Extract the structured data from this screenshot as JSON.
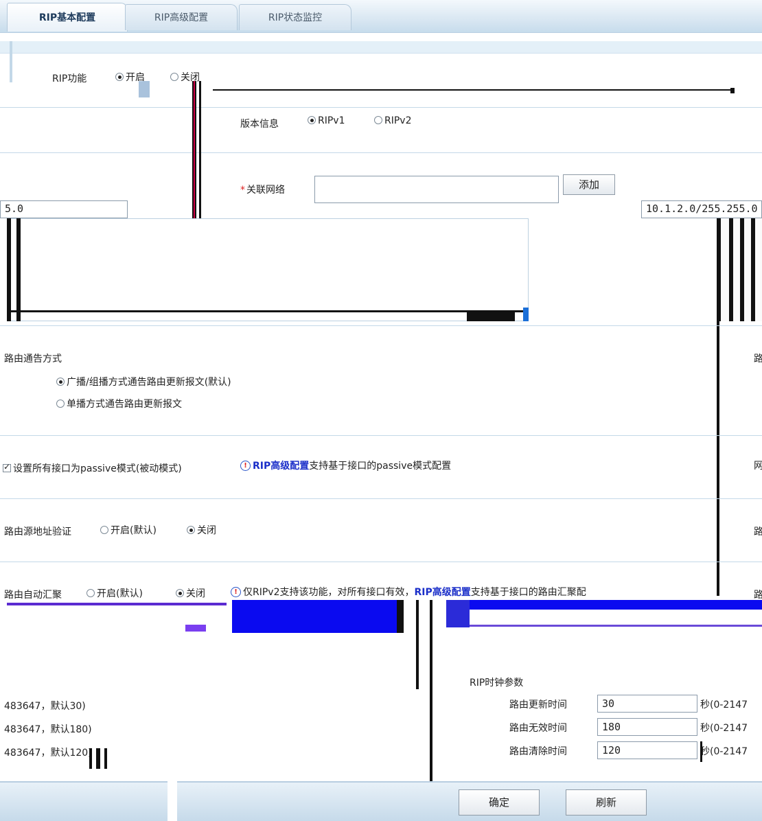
{
  "tabs": [
    {
      "label": "RIP基本配置",
      "active": true
    },
    {
      "label": "RIP高级配置",
      "active": false
    },
    {
      "label": "RIP状态监控",
      "active": false
    }
  ],
  "rip_function": {
    "label": "RIP功能",
    "on": "开启",
    "off": "关闭",
    "selected": "开启"
  },
  "version": {
    "label": "版本信息",
    "v1": "RIPv1",
    "v2": "RIPv2",
    "selected": "RIPv1"
  },
  "network": {
    "label": "关联网络",
    "input_value": "",
    "add_button": "添加",
    "left_value": "5.0",
    "right_value": "10.1.2.0/255.255.0"
  },
  "advertise": {
    "label": "路由通告方式",
    "broadcast": "广播/组播方式通告路由更新报文(默认)",
    "unicast": "单播方式通告路由更新报文",
    "selected": "broadcast"
  },
  "passive": {
    "label": "设置所有接口为passive模式(被动模式)",
    "checked": true,
    "note_link": "RIP高级配置",
    "note_text": "支持基于接口的passive模式配置"
  },
  "source_check": {
    "label": "路由源地址验证",
    "on": "开启(默认)",
    "off": "关闭",
    "selected": "关闭"
  },
  "auto_summary": {
    "label": "路由自动汇聚",
    "on": "开启(默认)",
    "off": "关闭",
    "selected": "关闭",
    "note_text": "仅RIPv2支持该功能，对所有接口有效，",
    "note_link": "RIP高级配置",
    "note_tail": "支持基于接口的路由汇聚配"
  },
  "timers": {
    "title": "RIP时钟参数",
    "rows": [
      {
        "label": "路由更新时间",
        "value": "30",
        "unit": "秒(0-2147",
        "left_hint": "483647，默认30)"
      },
      {
        "label": "路由无效时间",
        "value": "180",
        "unit": "秒(0-2147",
        "left_hint": "483647，默认180)"
      },
      {
        "label": "路由清除时间",
        "value": "120",
        "unit": "秒(0-2147",
        "left_hint": "483647，默认120)"
      }
    ]
  },
  "buttons": {
    "confirm": "确定",
    "refresh": "刷新"
  },
  "right_edge_labels": [
    "路",
    "网",
    "路",
    "路"
  ]
}
